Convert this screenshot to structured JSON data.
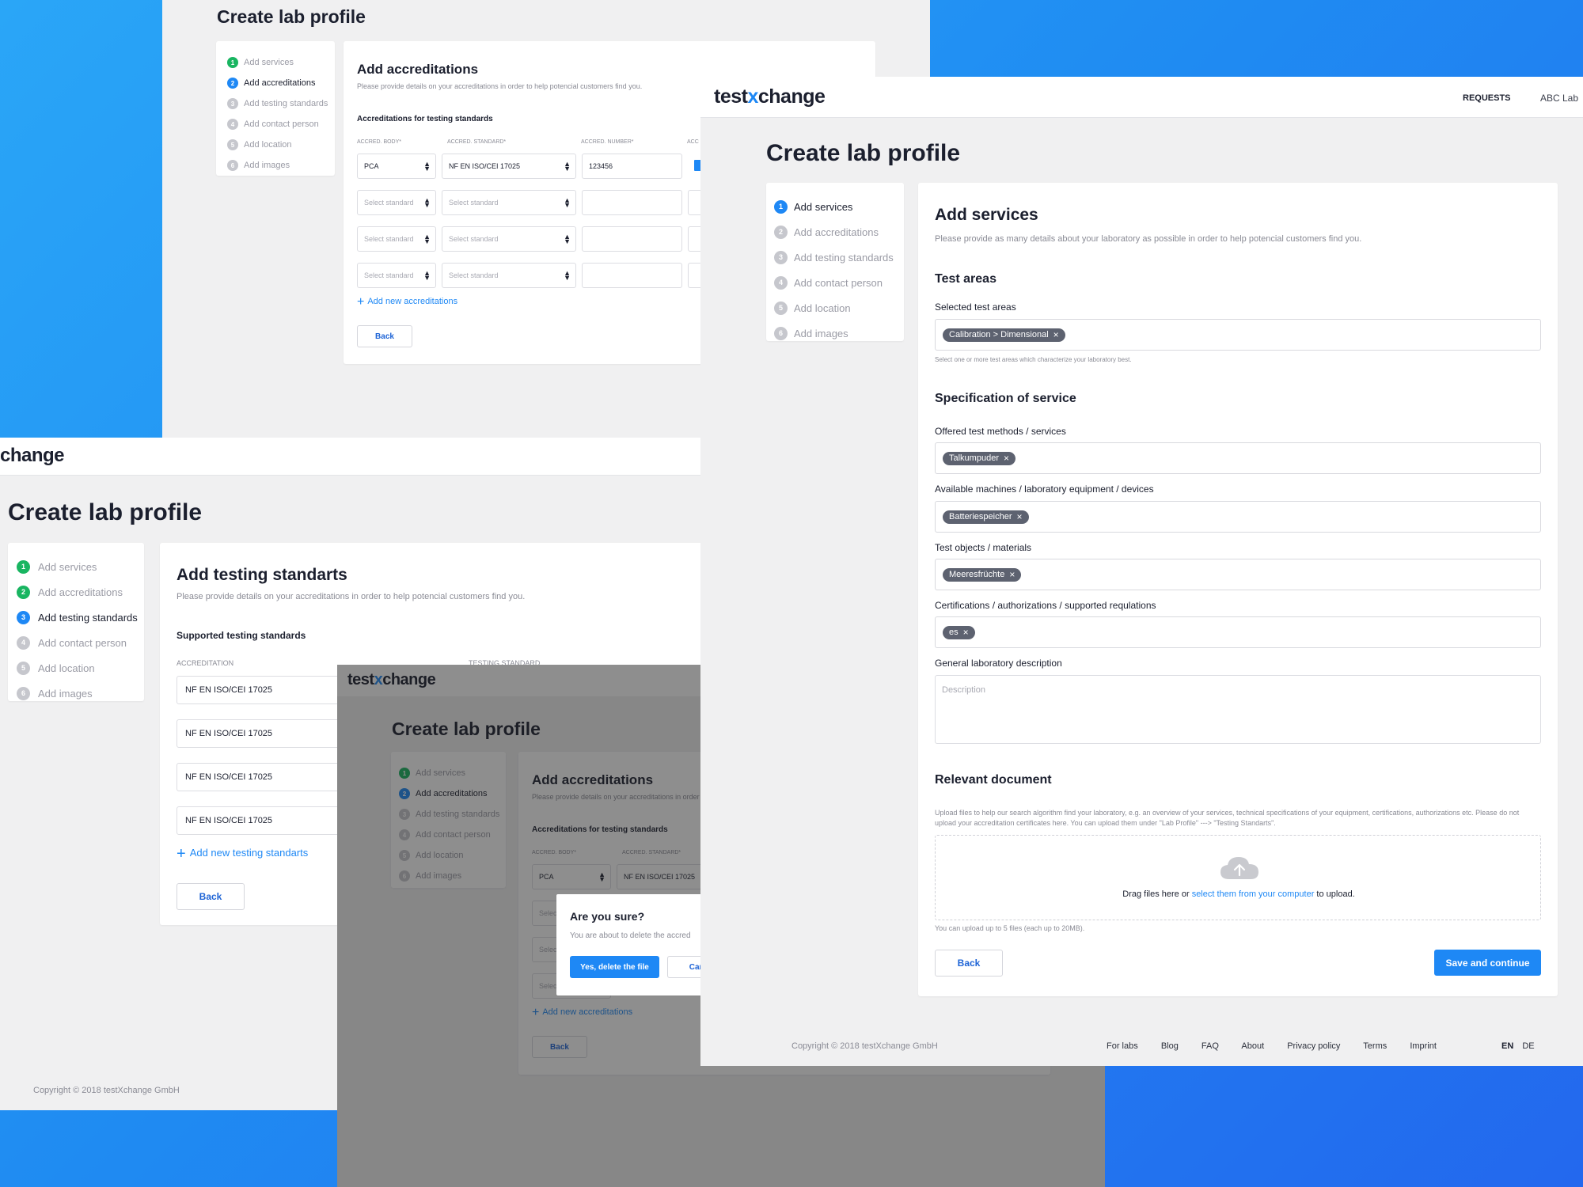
{
  "logo": {
    "part1": "test",
    "part2": "x",
    "part3": "change"
  },
  "page_title": "Create lab profile",
  "steps": [
    {
      "n": "1",
      "label": "Add services"
    },
    {
      "n": "2",
      "label": "Add accreditations"
    },
    {
      "n": "3",
      "label": "Add testing standards"
    },
    {
      "n": "4",
      "label": "Add contact person"
    },
    {
      "n": "5",
      "label": "Add location"
    },
    {
      "n": "6",
      "label": "Add images"
    }
  ],
  "accreditations": {
    "title": "Add accreditations",
    "subtitle": "Please provide details on your accreditations in order to help potencial customers find you.",
    "section": "Accreditations for testing standards",
    "col_body": "ACCRED. BODY*",
    "col_standard": "ACCRED. STANDARD*",
    "col_number": "ACCRED. NUMBER*",
    "col_extra": "ACC",
    "row1": {
      "body": "PCA",
      "standard": "NF EN ISO/CEI 17025",
      "number": "123456"
    },
    "select_standard_placeholder": "Select standard",
    "add_link": "Add new accreditations",
    "back": "Back"
  },
  "testing": {
    "title": "Add testing standarts",
    "subtitle": "Please provide details on your accreditations in order to help potencial customers find you.",
    "section": "Supported testing standards",
    "col_accreditation": "ACCREDITATION",
    "col_standard": "TESTING STANDARD",
    "rows": [
      "NF EN ISO/CEI 17025",
      "NF EN ISO/CEI 17025",
      "NF EN ISO/CEI 17025",
      "NF EN ISO/CEI 17025"
    ],
    "add_link": "Add new testing standarts",
    "back": "Back",
    "copyright": "Copyright © 2018 testXchange GmbH"
  },
  "dialog": {
    "title": "Are you sure?",
    "text": "You are about to delete the accred",
    "confirm": "Yes, delete the file",
    "cancel": "Canc"
  },
  "services": {
    "nav_requests": "REQUESTS",
    "nav_account": "ABC Lab",
    "title": "Add services",
    "subtitle": "Please provide as many details about your laboratory as possible in order to help potencial customers find you.",
    "test_areas_heading": "Test areas",
    "selected_label": "Selected test areas",
    "selected_chip": "Calibration > Dimensional",
    "test_areas_hint": "Select one or more test areas which characterize your laboratory best.",
    "spec_heading": "Specification of service",
    "methods_label": "Offered test methods / services",
    "methods_chip": "Talkumpuder",
    "machines_label": "Available machines / laboratory equipment / devices",
    "machines_chip": "Batteriespeicher",
    "objects_label": "Test objects / materials",
    "objects_chip": "Meeresfrüchte",
    "certs_label": "Certifications / authorizations / supported requlations",
    "certs_chip": "es",
    "desc_label": "General laboratory description",
    "desc_placeholder": "Description",
    "doc_heading": "Relevant document",
    "doc_text": "Upload files to help our search algorithm find your laboratory, e.g. an overview of your services, technical specifications of your equipment, certifications, authorizations etc. Please do not upload your accreditation certificates here. You can upload them under \"Lab Profile\" ---> \"Testing Standarts\".",
    "drop_text1": "Drag files here or",
    "drop_link": "select them from your computer",
    "drop_text2": "to upload.",
    "upload_limit": "You can upload up to 5 files (each up to 20MB).",
    "back": "Back",
    "save": "Save and continue"
  },
  "footer": {
    "copyright": "Copyright © 2018 testXchange GmbH",
    "links": [
      "For labs",
      "Blog",
      "FAQ",
      "About",
      "Privacy policy",
      "Terms",
      "Imprint"
    ],
    "lang_en": "EN",
    "lang_de": "DE"
  }
}
